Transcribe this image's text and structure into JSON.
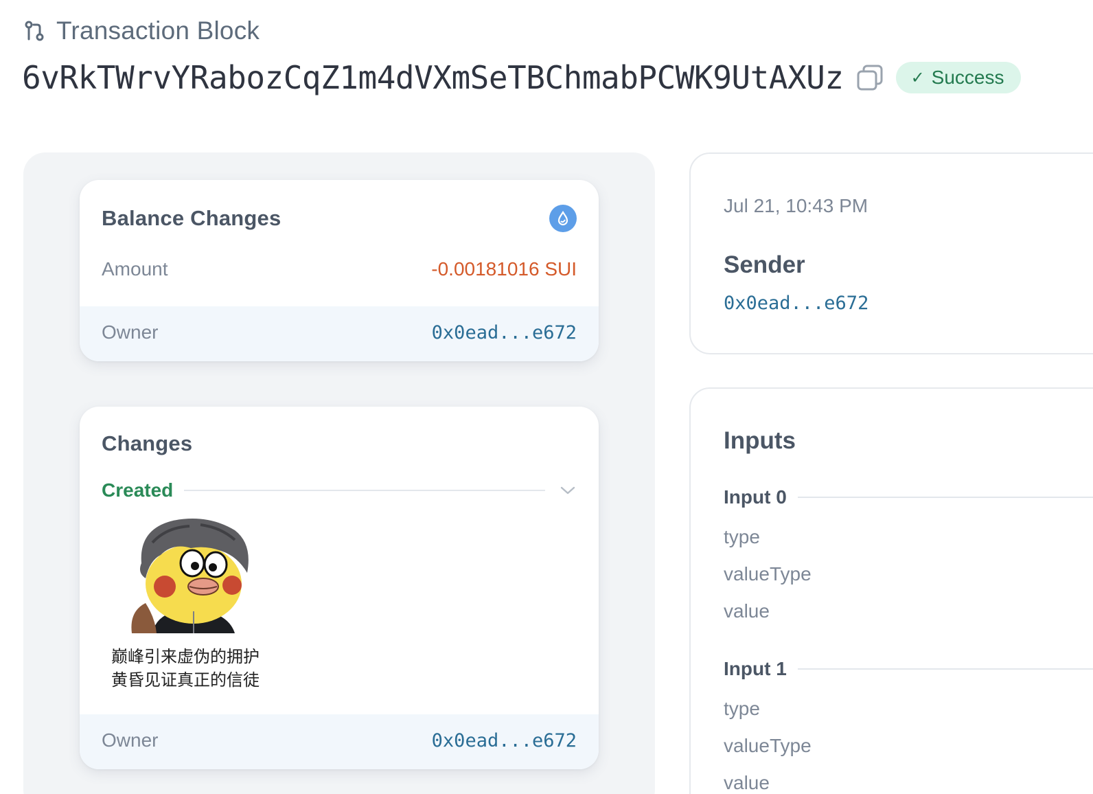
{
  "header": {
    "section_title": "Transaction Block",
    "digest": "6vRkTWrvYRabozCqZ1m4dVXmSeTBChmabPCWK9UtAXUz",
    "status": "Success"
  },
  "balance_changes": {
    "title": "Balance Changes",
    "amount_label": "Amount",
    "amount_value": "-0.00181016 SUI",
    "owner_label": "Owner",
    "owner_value": "0x0ead...e672"
  },
  "changes": {
    "title": "Changes",
    "created_label": "Created",
    "nft_caption_line1": "巅峰引来虚伪的拥护",
    "nft_caption_line2": "黄昏见证真正的信徒",
    "owner_label": "Owner",
    "owner_value": "0x0ead...e672"
  },
  "details": {
    "timestamp": "Jul 21, 10:43 PM",
    "sender_title": "Sender",
    "sender_value": "0x0ead...e672"
  },
  "inputs": {
    "title": "Inputs",
    "items": [
      {
        "label": "Input 0",
        "fields": [
          "type",
          "valueType",
          "value"
        ]
      },
      {
        "label": "Input 1",
        "fields": [
          "type",
          "valueType",
          "value"
        ]
      }
    ]
  },
  "colors": {
    "success_bg": "#dcf5ea",
    "success_text": "#237a4f",
    "negative_amount": "#d45a2a",
    "address_link": "#2a6d95",
    "created_green": "#2a8a57"
  }
}
